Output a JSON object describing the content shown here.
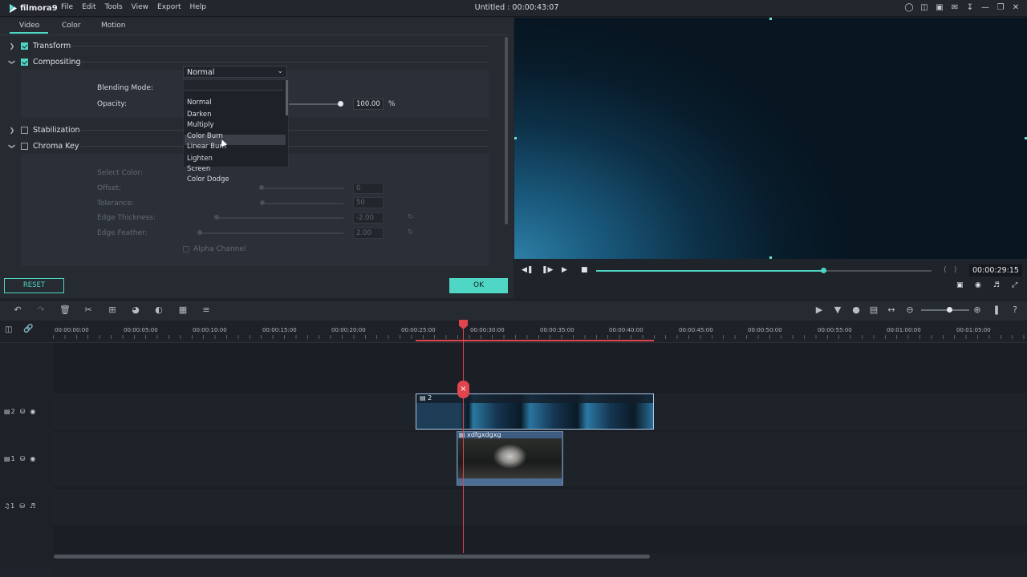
{
  "app": {
    "logo_text": "filmora9",
    "menu": [
      "File",
      "Edit",
      "Tools",
      "View",
      "Export",
      "Help"
    ],
    "title": "Untitled : 00:00:43:07",
    "window_icons": [
      "user-icon",
      "cart-icon",
      "save-icon",
      "mail-icon",
      "download-icon",
      "minimize-icon",
      "restore-icon",
      "close-icon"
    ]
  },
  "tabs": [
    "Video",
    "Color",
    "Motion"
  ],
  "sections": {
    "transform": "Transform",
    "compositing": "Compositing",
    "stabilization": "Stabilization",
    "chroma_key": "Chroma Key"
  },
  "compositing": {
    "blending_label": "Blending Mode:",
    "blending_value": "Normal",
    "opacity_label": "Opacity:",
    "opacity_value": "100.00",
    "opacity_unit": "%",
    "blend_options": [
      "Normal",
      "Darken",
      "Multiply",
      "Color Burn",
      "Linear Burn",
      "Lighten",
      "Screen",
      "Color Dodge"
    ],
    "highlighted_option": "Lighten"
  },
  "chroma": {
    "select_color": "Select Color:",
    "offset_label": "Offset:",
    "offset_value": "0",
    "tolerance_label": "Tolerance:",
    "tolerance_value": "50",
    "edge_thickness_label": "Edge Thickness:",
    "edge_thickness_value": "-2.00",
    "edge_feather_label": "Edge Feather:",
    "edge_feather_value": "2.00",
    "alpha_channel": "Alpha Channel"
  },
  "buttons": {
    "reset": "RESET",
    "ok": "OK"
  },
  "preview": {
    "timecode": "00:00:29:15",
    "progress": 0.677
  },
  "ruler_labels": [
    "00:00:00:00",
    "00:00:05:00",
    "00:00:10:00",
    "00:00:15:00",
    "00:00:20:00",
    "00:00:25:00",
    "00:00:30:00",
    "00:00:35:00",
    "00:00:40:00",
    "00:00:45:00",
    "00:00:50:00",
    "00:00:55:00",
    "00:01:00:00",
    "00:01:05:00"
  ],
  "tracks": {
    "video2_label": "2",
    "video1_label": "1",
    "audio1_label": "1",
    "clip2_name": "2",
    "clip1_name": "xdfgxdgxg"
  },
  "colors": {
    "accent": "#4fd6c4",
    "playhead": "#e0444c",
    "panel": "#262a31"
  }
}
